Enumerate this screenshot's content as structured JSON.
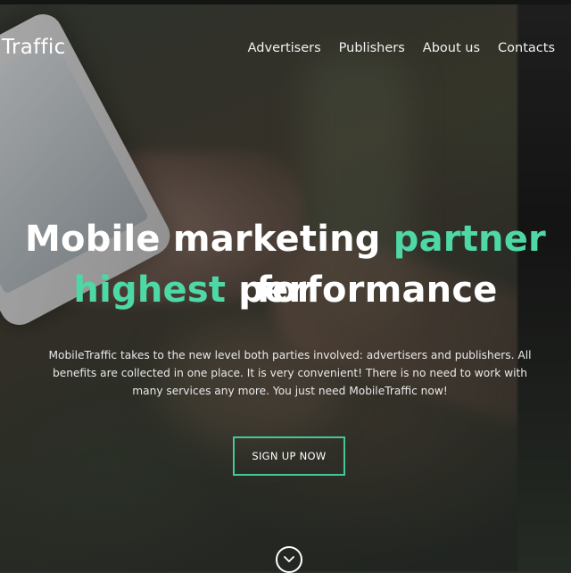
{
  "header": {
    "logo_text": "Traffic",
    "nav": [
      {
        "label": "Advertisers"
      },
      {
        "label": "Publishers"
      },
      {
        "label": "About us"
      },
      {
        "label": "Contacts"
      }
    ]
  },
  "hero": {
    "headline_line1_part1": "Mobile marketing ",
    "headline_line1_accent": "partner",
    "headline_line1_part2": " for",
    "headline_line2_accent": "highest",
    "headline_line2_part2": " performance",
    "description": "MobileTraffic takes to the new level both parties involved: advertisers and publishers. All benefits are collected in one place. It is very convenient! There is no need to work with many services any more. You just need MobileTraffic now!",
    "cta_label": "SIGN UP NOW",
    "scroll_icon": "chevron-down-icon"
  },
  "colors": {
    "accent": "#4ed8a6",
    "button_border": "#45c79a",
    "text": "#ffffff"
  }
}
